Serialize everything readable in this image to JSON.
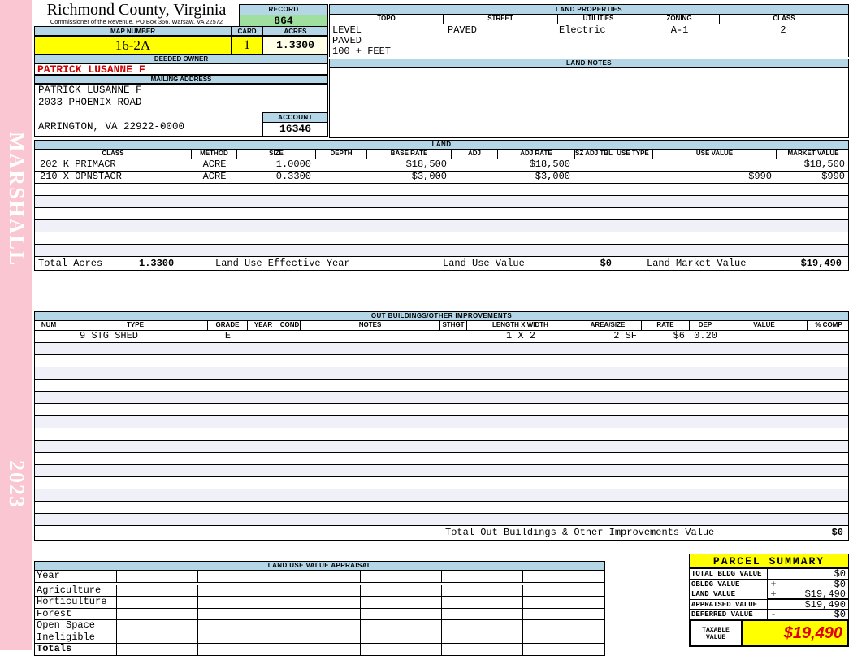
{
  "colors": {
    "blue": "#b5d6e6",
    "green": "#9fe09f",
    "yellow": "#ffff00",
    "pink": "#f9c6d2",
    "red": "#cc0000",
    "bigred": "#e00000",
    "cream": "#ffffe8",
    "altrow": "#f0f0f8"
  },
  "sidebar": {
    "vertical_top": "MARSHALL",
    "vertical_bottom": "2023"
  },
  "header": {
    "county_title": "Richmond County, Virginia",
    "county_subtitle": "Commissioner of the Revenue, PO Box 366, Warsaw, VA 22572",
    "record_label": "RECORD",
    "record_value": "864",
    "map_number_label": "MAP NUMBER",
    "map_number_value": "16-2A",
    "card_label": "CARD",
    "card_value": "1",
    "acres_label": "ACRES",
    "acres_value": "1.3300",
    "deeded_owner_label": "DEEDED OWNER",
    "deeded_owner_value": "PATRICK LUSANNE F",
    "mailing_address_label": "MAILING ADDRESS",
    "mailing_address_line1": "PATRICK LUSANNE F",
    "mailing_address_line2": "2033 PHOENIX ROAD",
    "mailing_address_city": "ARRINGTON, VA 22922-0000",
    "account_label": "ACCOUNT",
    "account_value": "16346"
  },
  "land_properties": {
    "title": "LAND PROPERTIES",
    "columns": [
      "TOPO",
      "STREET",
      "UTILITIES",
      "ZONING",
      "CLASS"
    ],
    "values": [
      "LEVEL",
      "PAVED",
      "Electric",
      "A-1",
      "2"
    ],
    "topo_extra1": "PAVED",
    "topo_extra2": "100 + FEET"
  },
  "land_notes": {
    "title": "LAND NOTES"
  },
  "land_table": {
    "title": "LAND",
    "columns": [
      "CLASS",
      "METHOD",
      "SIZE",
      "DEPTH",
      "BASE RATE",
      "ADJ",
      "ADJ RATE",
      "SZ ADJ TBL",
      "USE TYPE",
      "USE VALUE",
      "MARKET VALUE"
    ],
    "rows": [
      [
        "202 K PRIMACR",
        "ACRE",
        "1.0000",
        "",
        "$18,500",
        "",
        "$18,500",
        "",
        "",
        "",
        "$18,500"
      ],
      [
        "210 X OPNSTACR",
        "ACRE",
        "0.3300",
        "",
        "$3,000",
        "",
        "$3,000",
        "",
        "",
        "$990",
        "$990"
      ]
    ],
    "totals": {
      "total_acres_label": "Total Acres",
      "total_acres_value": "1.3300",
      "effective_year_label": "Land Use Effective Year",
      "use_value_label": "Land Use Value",
      "use_value": "$0",
      "market_value_label": "Land Market Value",
      "market_value": "$19,490"
    }
  },
  "out_buildings": {
    "title": "OUT BUILDINGS/OTHER IMPROVEMENTS",
    "columns": [
      "NUM",
      "TYPE",
      "GRADE",
      "YEAR",
      "COND",
      "NOTES",
      "STHGT",
      "LENGTH X WIDTH",
      "AREA/SIZE",
      "RATE",
      "DEP",
      "VALUE",
      "% COMP"
    ],
    "rows": [
      [
        "",
        "9 STG SHED",
        "E",
        "",
        "",
        "",
        "",
        "1 X 2",
        "2 SF",
        "$6",
        "0.20",
        "",
        ""
      ]
    ],
    "total_label": "Total Out Buildings & Other Improvements Value",
    "total_value": "$0"
  },
  "land_use_appraisal": {
    "title": "LAND USE VALUE APPRAISAL",
    "row_labels": [
      "Year",
      "Agriculture",
      "Horticulture",
      "Forest",
      "Open Space",
      "Ineligible",
      "Totals"
    ]
  },
  "parcel_summary": {
    "title": "PARCEL SUMMARY",
    "rows": [
      {
        "label": "TOTAL BLDG VALUE",
        "op": "",
        "value": "$0"
      },
      {
        "label": "OBLDG VALUE",
        "op": "+",
        "value": "$0"
      },
      {
        "label": "LAND VALUE",
        "op": "+",
        "value": "$19,490"
      },
      {
        "label": "APPRAISED VALUE",
        "op": "",
        "value": "$19,490"
      },
      {
        "label": "DEFERRED VALUE",
        "op": "-",
        "value": "$0"
      }
    ],
    "taxable_label_line1": "TAXABLE",
    "taxable_label_line2": "VALUE",
    "taxable_value": "$19,490"
  }
}
